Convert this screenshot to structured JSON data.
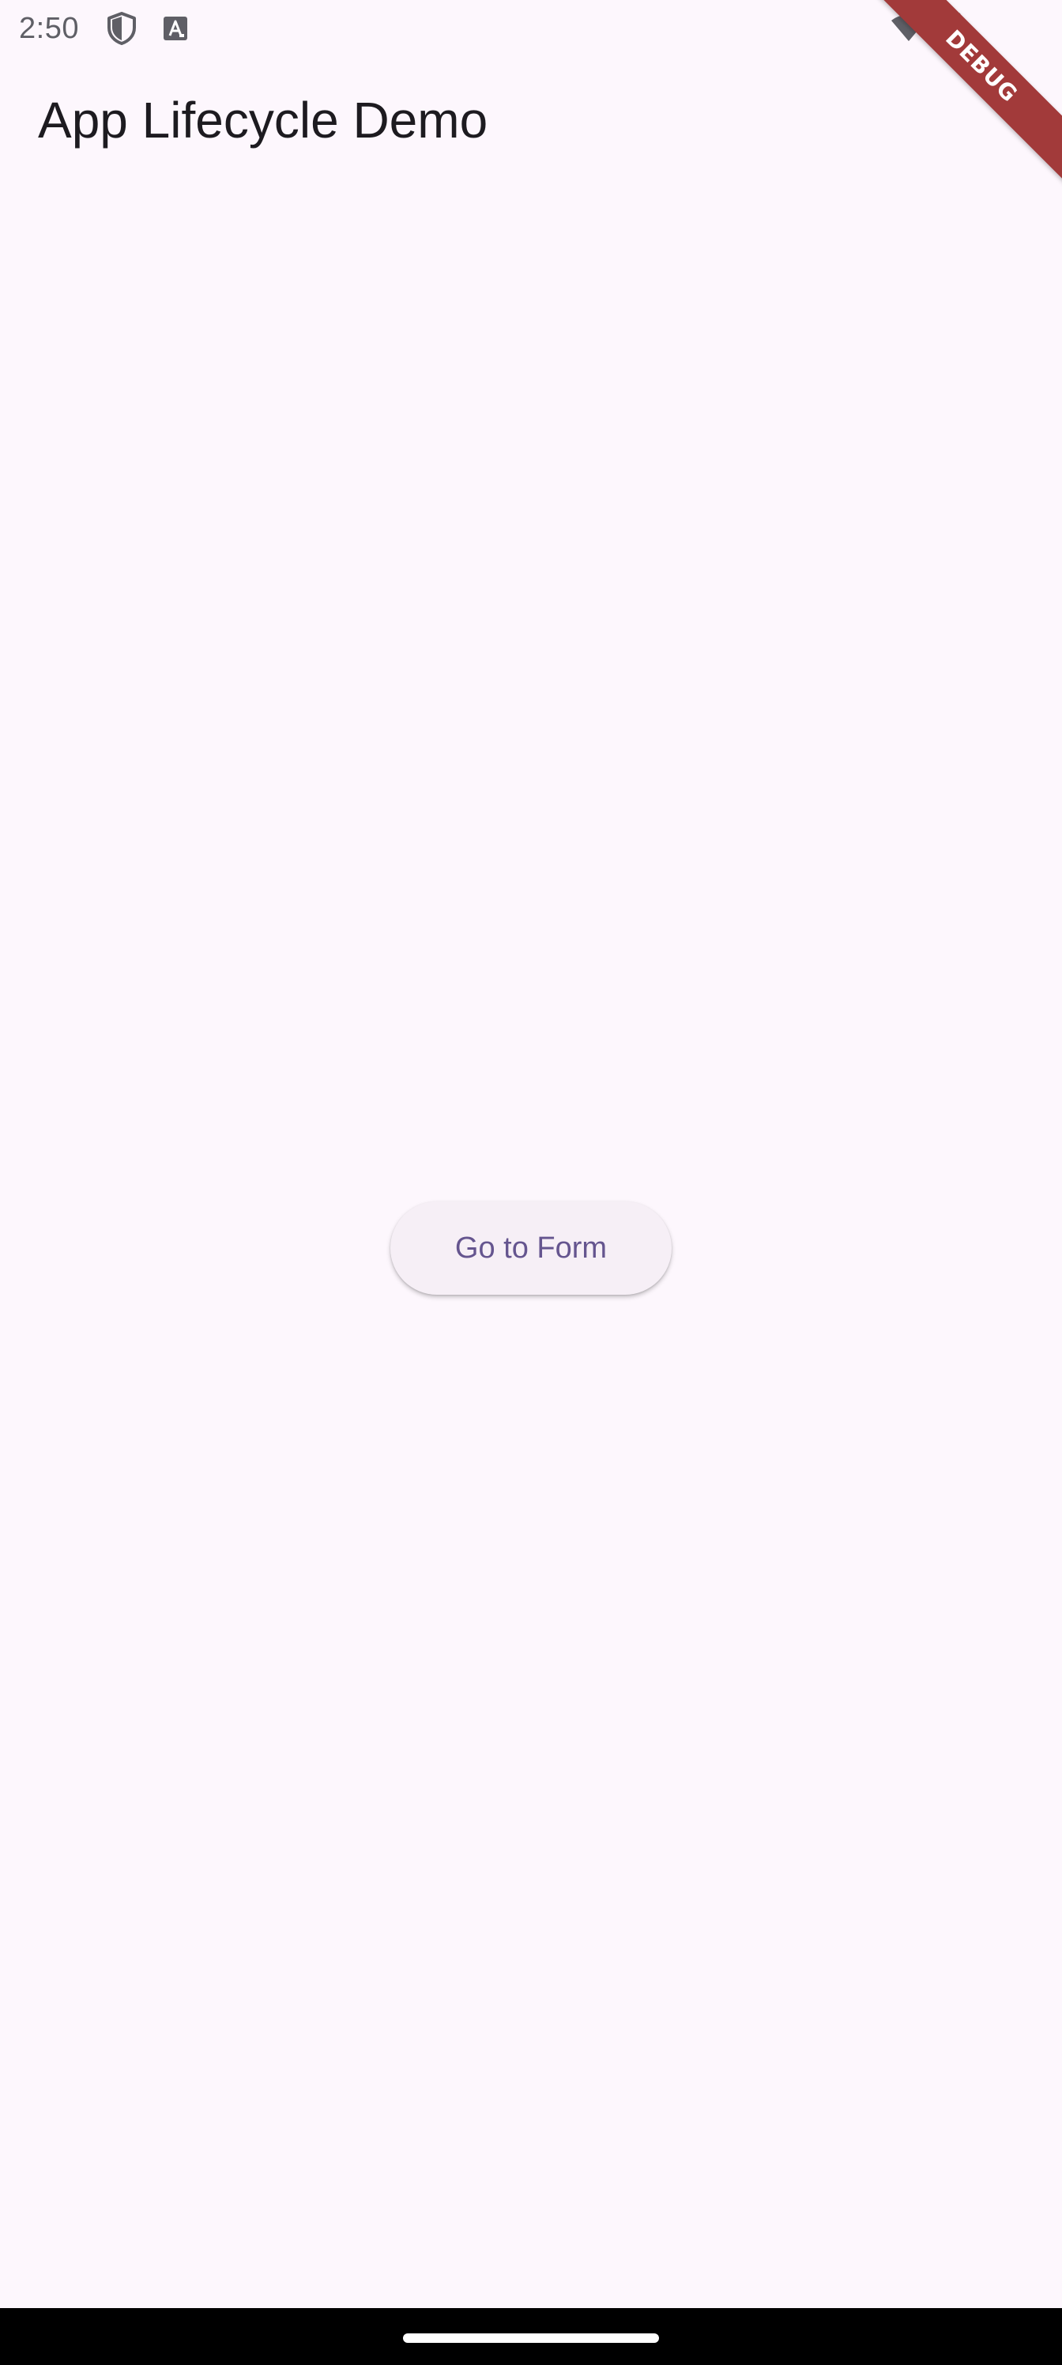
{
  "status_bar": {
    "time": "2:50",
    "icons": [
      "shield-icon",
      "font-icon",
      "wifi-icon",
      "signal-icon"
    ],
    "icon_color": "#5f5f66"
  },
  "debug_banner": {
    "label": "DEBUG",
    "color": "#a23a3a"
  },
  "app_bar": {
    "title": "App Lifecycle Demo"
  },
  "main": {
    "button_label": "Go to Form",
    "button_text_color": "#65558f"
  },
  "theme": {
    "background": "#fdf7fd",
    "nav_bar": "#000000"
  }
}
